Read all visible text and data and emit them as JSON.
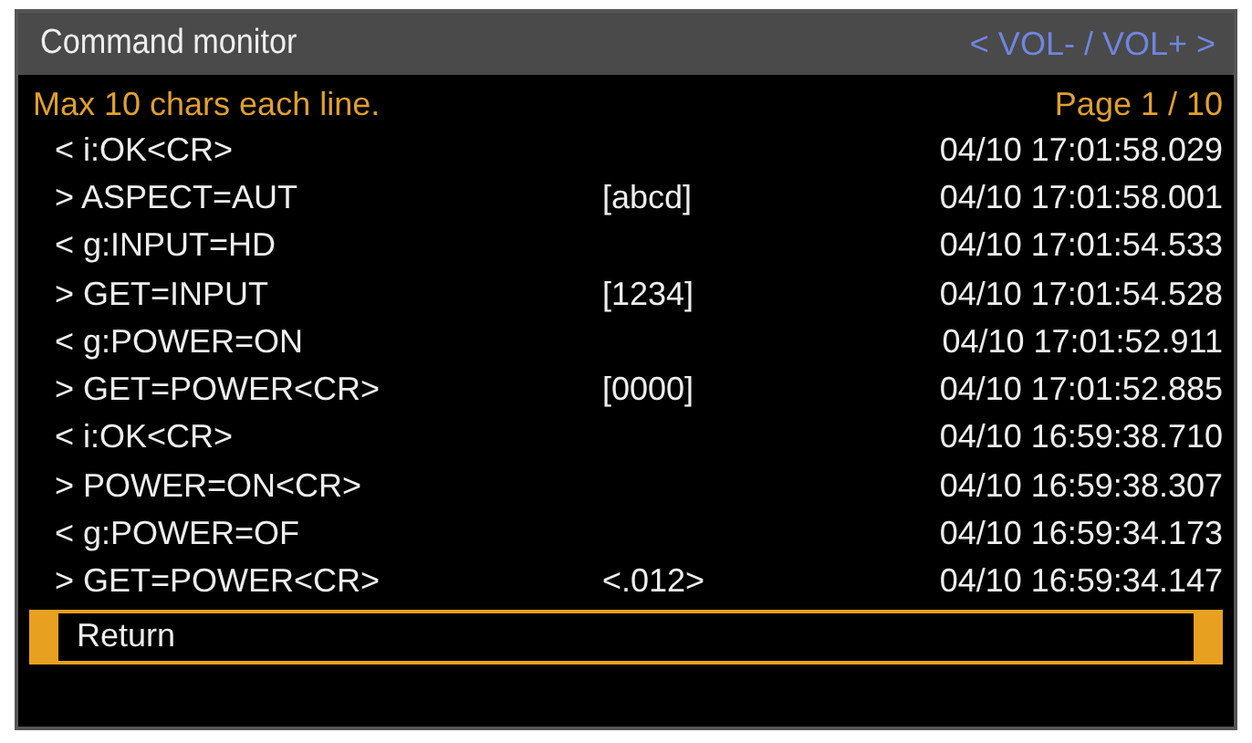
{
  "window": {
    "title": "Command monitor",
    "hint": "< VOL- / VOL+ >"
  },
  "info": {
    "note": "Max 10 chars each line.",
    "page": "Page 1 / 10"
  },
  "rows": [
    {
      "command": "< i:OK<CR>",
      "code": "",
      "time": "04/10 17:01:58.029"
    },
    {
      "command": "> ASPECT=AUT",
      "code": "[abcd]",
      "time": "04/10 17:01:58.001"
    },
    {
      "command": "< g:INPUT=HD",
      "code": "",
      "time": "04/10 17:01:54.533"
    },
    {
      "command": "> GET=INPUT",
      "code": "[1234]",
      "time": "04/10 17:01:54.528"
    },
    {
      "command": "< g:POWER=ON",
      "code": "",
      "time": "04/10 17:01:52.911"
    },
    {
      "command": "> GET=POWER<CR>",
      "code": "[0000]",
      "time": "04/10 17:01:52.885"
    },
    {
      "command": "< i:OK<CR>",
      "code": "",
      "time": "04/10 16:59:38.710"
    },
    {
      "command": "> POWER=ON<CR>",
      "code": "",
      "time": "04/10 16:59:38.307"
    },
    {
      "command": "< g:POWER=OF",
      "code": "",
      "time": "04/10 16:59:34.173"
    },
    {
      "command": "> GET=POWER<CR>",
      "code": "<.012>",
      "time": "04/10 16:59:34.147"
    }
  ],
  "return_button": {
    "label": "Return",
    "selected": true
  }
}
